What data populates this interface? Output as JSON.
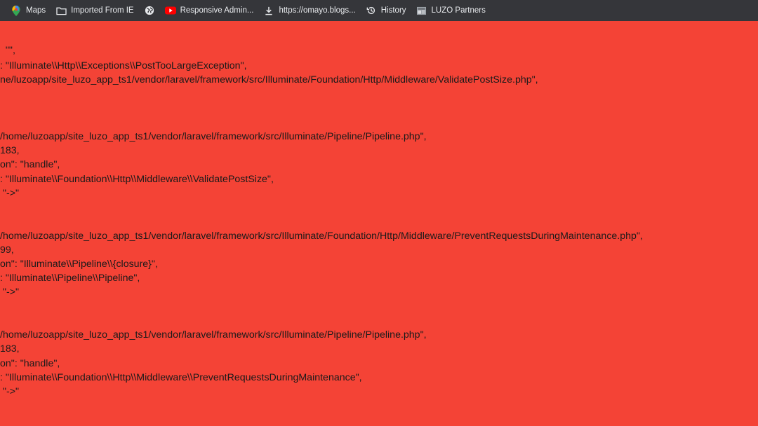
{
  "bookmarks": [
    {
      "icon": "maps-pin-icon",
      "label": "Maps"
    },
    {
      "icon": "folder-icon",
      "label": "Imported From IE"
    },
    {
      "icon": "globe-icon",
      "label": ""
    },
    {
      "icon": "youtube-icon",
      "label": "Responsive Admin..."
    },
    {
      "icon": "download-icon",
      "label": "https://omayo.blogs..."
    },
    {
      "icon": "history-icon",
      "label": "History"
    },
    {
      "icon": "page-icon",
      "label": "LUZO Partners"
    }
  ],
  "lines": [
    "  \"\",",
    ": \"Illuminate\\\\Http\\\\Exceptions\\\\PostTooLargeException\",",
    "ne/luzoapp/site_luzo_app_ts1/vendor/laravel/framework/src/Illuminate/Foundation/Http/Middleware/ValidatePostSize.php\",",
    "/home/luzoapp/site_luzo_app_ts1/vendor/laravel/framework/src/Illuminate/Pipeline/Pipeline.php\",",
    "183,",
    "on\": \"handle\",",
    ": \"Illuminate\\\\Foundation\\\\Http\\\\Middleware\\\\ValidatePostSize\",",
    " \"->\"",
    "/home/luzoapp/site_luzo_app_ts1/vendor/laravel/framework/src/Illuminate/Foundation/Http/Middleware/PreventRequestsDuringMaintenance.php\",",
    "99,",
    "on\": \"Illuminate\\\\Pipeline\\\\{closure}\",",
    ": \"Illuminate\\\\Pipeline\\\\Pipeline\",",
    " \"->\"",
    "/home/luzoapp/site_luzo_app_ts1/vendor/laravel/framework/src/Illuminate/Pipeline/Pipeline.php\",",
    "183,",
    "on\": \"handle\",",
    ": \"Illuminate\\\\Foundation\\\\Http\\\\Middleware\\\\PreventRequestsDuringMaintenance\",",
    " \"->\""
  ]
}
